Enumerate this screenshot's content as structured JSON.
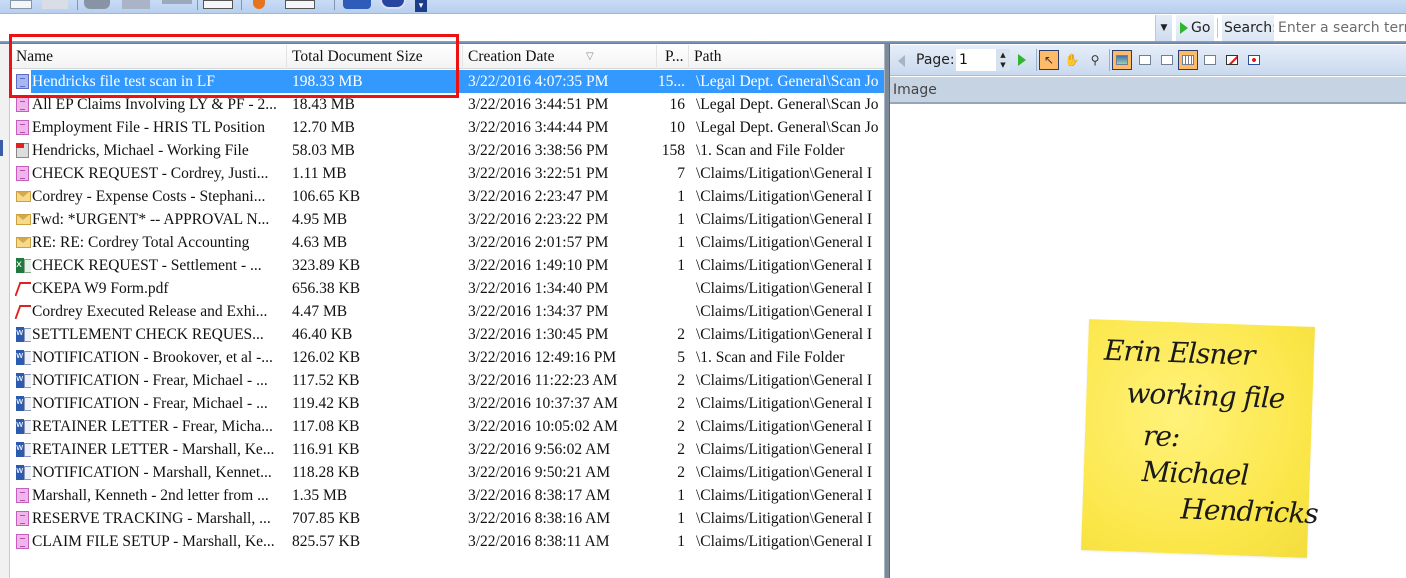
{
  "toolbar": {
    "overflow_icon": "chevron-down-icon"
  },
  "search": {
    "go_label": "Go",
    "search_label": "Search:",
    "placeholder": "Enter a search term",
    "value": ""
  },
  "list": {
    "columns": {
      "name": "Name",
      "size": "Total Document Size",
      "date": "Creation Date",
      "pages": "P...",
      "path": "Path"
    },
    "sort_indicator": "▽",
    "selected_index": 0,
    "rows": [
      {
        "icon": "doc-blue",
        "name": "Hendricks file test scan in LF",
        "size": "198.33 MB",
        "date": "3/22/2016 4:07:35 PM",
        "pages": "15...",
        "path": "\\Legal Dept. General\\Scan Jo"
      },
      {
        "icon": "doc-pink",
        "name": "All EP Claims Involving LY & PF - 2...",
        "size": "18.43 MB",
        "date": "3/22/2016 3:44:51 PM",
        "pages": "16",
        "path": "\\Legal Dept. General\\Scan Jo"
      },
      {
        "icon": "doc-pink",
        "name": "Employment File - HRIS TL Position",
        "size": "12.70 MB",
        "date": "3/22/2016 3:44:44 PM",
        "pages": "10",
        "path": "\\Legal Dept. General\\Scan Jo"
      },
      {
        "icon": "pdf-scan",
        "name": "Hendricks, Michael - Working File",
        "size": "58.03 MB",
        "date": "3/22/2016 3:38:56 PM",
        "pages": "158",
        "path": "\\1. Scan and File Folder"
      },
      {
        "icon": "doc-pink",
        "name": "CHECK REQUEST - Cordrey, Justi...",
        "size": "1.11 MB",
        "date": "3/22/2016 3:22:51 PM",
        "pages": "7",
        "path": "\\Claims/Litigation\\General I"
      },
      {
        "icon": "email",
        "name": "Cordrey - Expense Costs - Stephani...",
        "size": "106.65 KB",
        "date": "3/22/2016 2:23:47 PM",
        "pages": "1",
        "path": "\\Claims/Litigation\\General I"
      },
      {
        "icon": "email",
        "name": "Fwd: *URGENT* -- APPROVAL N...",
        "size": "4.95 MB",
        "date": "3/22/2016 2:23:22 PM",
        "pages": "1",
        "path": "\\Claims/Litigation\\General I"
      },
      {
        "icon": "email",
        "name": "RE: RE: Cordrey Total Accounting",
        "size": "4.63 MB",
        "date": "3/22/2016 2:01:57 PM",
        "pages": "1",
        "path": "\\Claims/Litigation\\General I"
      },
      {
        "icon": "excel",
        "name": "CHECK REQUEST - Settlement - ...",
        "size": "323.89 KB",
        "date": "3/22/2016 1:49:10 PM",
        "pages": "1",
        "path": "\\Claims/Litigation\\General I"
      },
      {
        "icon": "pdf",
        "name": "CKEPA W9 Form.pdf",
        "size": "656.38 KB",
        "date": "3/22/2016 1:34:40 PM",
        "pages": "",
        "path": "\\Claims/Litigation\\General I"
      },
      {
        "icon": "pdf",
        "name": "Cordrey Executed Release and Exhi...",
        "size": "4.47 MB",
        "date": "3/22/2016 1:34:37 PM",
        "pages": "",
        "path": "\\Claims/Litigation\\General I"
      },
      {
        "icon": "word",
        "name": "SETTLEMENT CHECK REQUES...",
        "size": "46.40 KB",
        "date": "3/22/2016 1:30:45 PM",
        "pages": "2",
        "path": "\\Claims/Litigation\\General I"
      },
      {
        "icon": "word",
        "name": "NOTIFICATION - Brookover, et al -...",
        "size": "126.02 KB",
        "date": "3/22/2016 12:49:16 PM",
        "pages": "5",
        "path": "\\1. Scan and File Folder"
      },
      {
        "icon": "word",
        "name": "NOTIFICATION - Frear, Michael - ...",
        "size": "117.52 KB",
        "date": "3/22/2016 11:22:23 AM",
        "pages": "2",
        "path": "\\Claims/Litigation\\General I"
      },
      {
        "icon": "word",
        "name": "NOTIFICATION - Frear, Michael - ...",
        "size": "119.42 KB",
        "date": "3/22/2016 10:37:37 AM",
        "pages": "2",
        "path": "\\Claims/Litigation\\General I"
      },
      {
        "icon": "word",
        "name": "RETAINER LETTER - Frear, Micha...",
        "size": "117.08 KB",
        "date": "3/22/2016 10:05:02 AM",
        "pages": "2",
        "path": "\\Claims/Litigation\\General I"
      },
      {
        "icon": "word",
        "name": "RETAINER LETTER - Marshall, Ke...",
        "size": "116.91 KB",
        "date": "3/22/2016 9:56:02 AM",
        "pages": "2",
        "path": "\\Claims/Litigation\\General I"
      },
      {
        "icon": "word",
        "name": "NOTIFICATION - Marshall, Kennet...",
        "size": "118.28 KB",
        "date": "3/22/2016 9:50:21 AM",
        "pages": "2",
        "path": "\\Claims/Litigation\\General I"
      },
      {
        "icon": "doc-pink",
        "name": "Marshall, Kenneth - 2nd letter from ...",
        "size": "1.35 MB",
        "date": "3/22/2016 8:38:17 AM",
        "pages": "1",
        "path": "\\Claims/Litigation\\General I"
      },
      {
        "icon": "doc-pink",
        "name": "RESERVE TRACKING - Marshall, ...",
        "size": "707.85 KB",
        "date": "3/22/2016 8:38:16 AM",
        "pages": "1",
        "path": "\\Claims/Litigation\\General I"
      },
      {
        "icon": "doc-pink",
        "name": "CLAIM FILE SETUP - Marshall, Ke...",
        "size": "825.57 KB",
        "date": "3/22/2016 8:38:11 AM",
        "pages": "1",
        "path": "\\Claims/Litigation\\General I"
      }
    ]
  },
  "viewer": {
    "page_label": "Page:",
    "page_value": "1",
    "section_label": "Image",
    "tools": [
      {
        "name": "select-pointer",
        "glyph": "↖",
        "active": true
      },
      {
        "name": "pan-hand",
        "glyph": "✋",
        "active": false
      },
      {
        "name": "zoom-region",
        "glyph": "🔍",
        "active": false
      },
      {
        "name": "image-view",
        "glyph": "",
        "active": true
      },
      {
        "name": "text-view",
        "glyph": "",
        "active": false
      },
      {
        "name": "field-view",
        "glyph": "",
        "active": false
      },
      {
        "name": "thumbnails-view",
        "glyph": "",
        "active": true
      },
      {
        "name": "page-view",
        "glyph": "",
        "active": false
      },
      {
        "name": "annotate",
        "glyph": "",
        "active": false
      },
      {
        "name": "settings",
        "glyph": "",
        "active": false
      }
    ]
  },
  "sticky_note": {
    "lines": [
      "Erin Elsner",
      "working file",
      "re:",
      "Michael",
      "Hendricks"
    ],
    "color": "#fbe648"
  },
  "colors": {
    "selection": "#3399ff",
    "highlight_box": "#ee1111",
    "go_arrow": "#2fb52f",
    "active_tool": "#fdbb6a"
  }
}
